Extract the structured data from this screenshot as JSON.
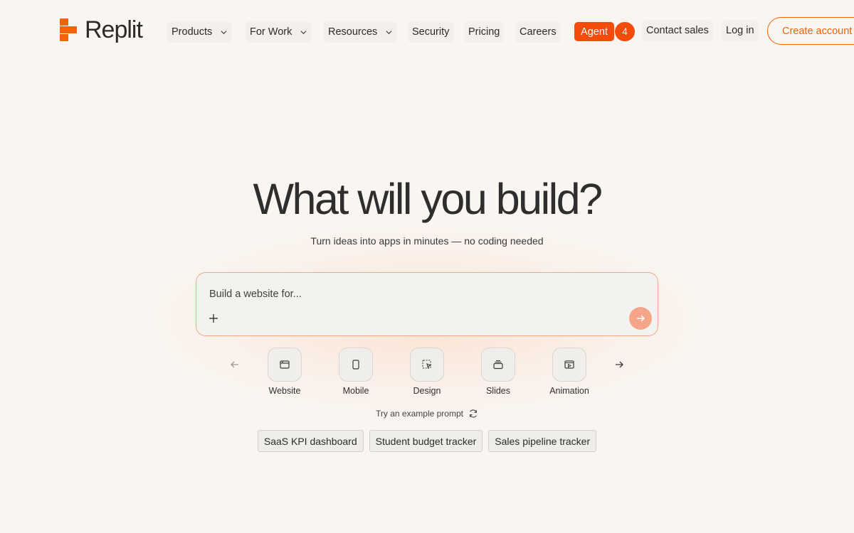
{
  "brand": {
    "name": "Replit",
    "accent": "#f26207",
    "agent_color": "#f24b0a"
  },
  "nav": {
    "items": [
      {
        "label": "Products",
        "dropdown": true
      },
      {
        "label": "For Work",
        "dropdown": true
      },
      {
        "label": "Resources",
        "dropdown": true
      },
      {
        "label": "Security",
        "dropdown": false
      },
      {
        "label": "Pricing",
        "dropdown": false
      },
      {
        "label": "Careers",
        "dropdown": false
      }
    ],
    "agent": {
      "label": "Agent",
      "badge": "4"
    },
    "contact_sales": "Contact sales",
    "login": "Log in",
    "create_account": "Create account"
  },
  "hero": {
    "title": "What will you build?",
    "subtitle": "Turn ideas into apps in minutes — no coding needed"
  },
  "prompt": {
    "placeholder": "Build a website for..."
  },
  "categories": [
    {
      "label": "Website",
      "icon": "browser-window-icon"
    },
    {
      "label": "Mobile",
      "icon": "phone-icon"
    },
    {
      "label": "Design",
      "icon": "design-cursor-icon"
    },
    {
      "label": "Slides",
      "icon": "slides-stack-icon"
    },
    {
      "label": "Animation",
      "icon": "play-window-icon"
    }
  ],
  "examples": {
    "label": "Try an example prompt",
    "chips": [
      "SaaS KPI dashboard",
      "Student budget tracker",
      "Sales pipeline tracker"
    ]
  }
}
